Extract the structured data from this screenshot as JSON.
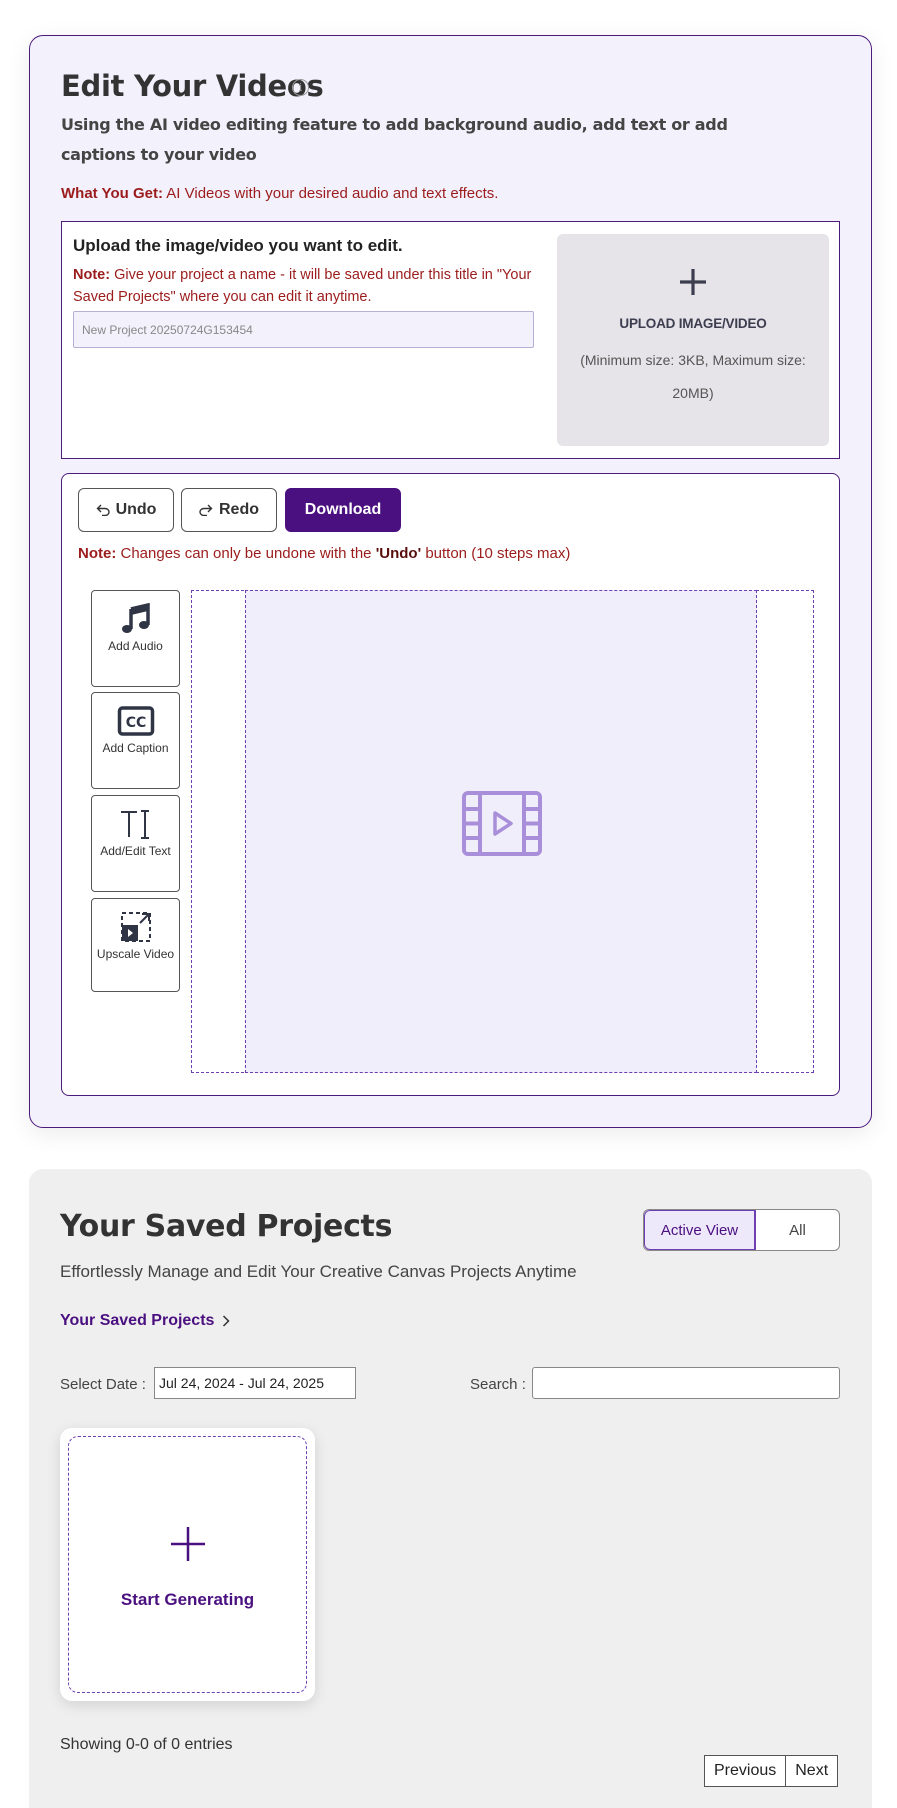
{
  "editor": {
    "title": "Edit Your Videos",
    "info_icon": "info-icon",
    "subtitle": "Using the AI video editing feature to add background audio, add text or add captions to your video",
    "what_get_label": "What You Get:",
    "what_get_text": " AI Videos with your desired audio and text effects.",
    "upload": {
      "heading": "Upload the image/video you want to edit.",
      "note_label": "Note:",
      "note_text": " Give your project a name - it will be saved under this title in \"Your Saved Projects\" where you can edit it anytime.",
      "project_name_placeholder": "New Project 20250724G153454",
      "drop_icon": "plus-icon",
      "drop_label": "UPLOAD IMAGE/VIDEO",
      "drop_hint": "(Minimum size: 3KB, Maximum size: 20MB)"
    },
    "toolbar": {
      "undo_label": "Undo",
      "redo_label": "Redo",
      "download_label": "Download",
      "note_label": "Note:",
      "note_text_before": " Changes can only be undone with the ",
      "note_undo": "'Undo'",
      "note_text_after": " button (10 steps max)"
    },
    "tools": [
      {
        "label": "Add Audio",
        "icon": "music-note-icon"
      },
      {
        "label": "Add Caption",
        "icon": "closed-caption-icon"
      },
      {
        "label": "Add/Edit Text",
        "icon": "text-cursor-icon"
      },
      {
        "label": "Upscale Video",
        "icon": "upscale-icon"
      }
    ],
    "canvas_icon": "film-play-icon",
    "colors": {
      "accent": "#4b1080",
      "note": "#9b1c1c",
      "card_bg": "#f3f1fc"
    }
  },
  "saved": {
    "title": "Your Saved Projects",
    "view_active_label": "Active View",
    "view_all_label": "All",
    "subtitle": "Effortlessly Manage and Edit Your Creative Canvas Projects Anytime",
    "link_label": "Your Saved Projects",
    "select_date_label": "Select Date :",
    "date_range": "Jul 24, 2024 - Jul 24, 2025",
    "search_label": "Search :",
    "search_value": "",
    "start_label": "Start Generating",
    "showing_text": "Showing 0-0 of 0 entries",
    "prev_label": "Previous",
    "next_label": "Next"
  }
}
